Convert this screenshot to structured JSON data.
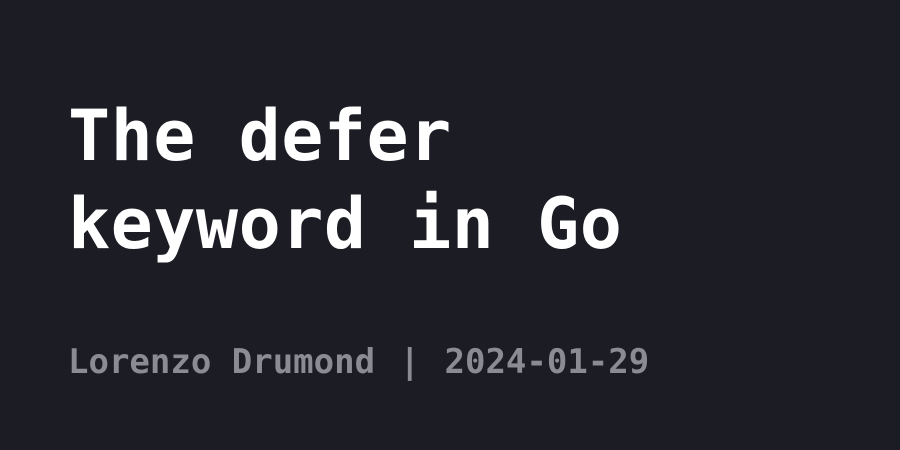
{
  "post": {
    "title_lines": [
      "The defer",
      "keyword in Go"
    ],
    "author": "Lorenzo Drumond",
    "separator": "|",
    "date": "2024-01-29"
  },
  "colors": {
    "background": "#1b1c24",
    "title": "#ffffff",
    "meta": "#8b8c93"
  }
}
